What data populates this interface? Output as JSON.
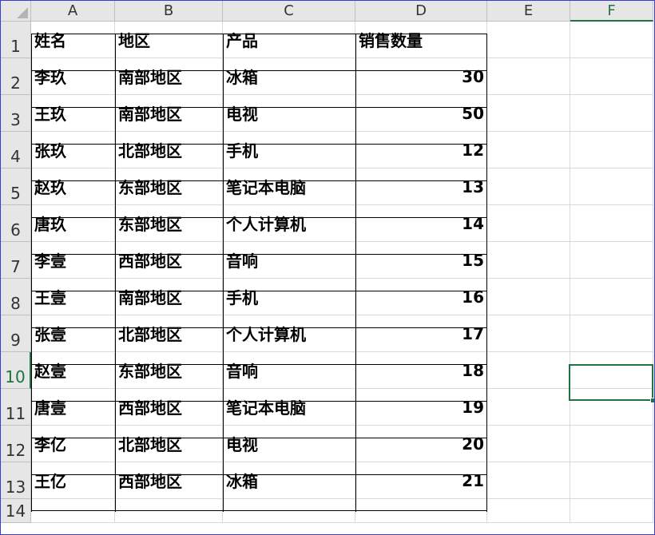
{
  "columns": [
    "A",
    "B",
    "C",
    "D",
    "E",
    "F"
  ],
  "rows": [
    "1",
    "2",
    "3",
    "4",
    "5",
    "6",
    "7",
    "8",
    "9",
    "10",
    "11",
    "12",
    "13",
    "14"
  ],
  "active_column": "F",
  "active_row": "10",
  "accent_color": "#217346",
  "sheet": [
    [
      "姓名",
      "地区",
      "产品",
      "销售数量"
    ],
    [
      "李玖",
      "南部地区",
      "冰箱",
      "30"
    ],
    [
      "王玖",
      "南部地区",
      "电视",
      "50"
    ],
    [
      "张玖",
      "北部地区",
      "手机",
      "12"
    ],
    [
      "赵玖",
      "东部地区",
      "笔记本电脑",
      "13"
    ],
    [
      "唐玖",
      "东部地区",
      "个人计算机",
      "14"
    ],
    [
      "李壹",
      "西部地区",
      "音响",
      "15"
    ],
    [
      "王壹",
      "南部地区",
      "手机",
      "16"
    ],
    [
      "张壹",
      "北部地区",
      "个人计算机",
      "17"
    ],
    [
      "赵壹",
      "东部地区",
      "音响",
      "18"
    ],
    [
      "唐壹",
      "西部地区",
      "笔记本电脑",
      "19"
    ],
    [
      "李亿",
      "北部地区",
      "电视",
      "20"
    ],
    [
      "王亿",
      "西部地区",
      "冰箱",
      "21"
    ]
  ]
}
